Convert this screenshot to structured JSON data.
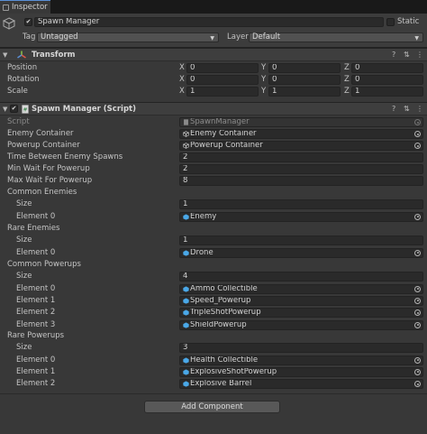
{
  "tab": {
    "label": "Inspector"
  },
  "gameobject": {
    "active": true,
    "name": "Spawn Manager",
    "static_label": "Static",
    "tag_label": "Tag",
    "tag_value": "Untagged",
    "layer_label": "Layer",
    "layer_value": "Default"
  },
  "transform": {
    "title": "Transform",
    "rows": [
      {
        "label": "Position",
        "x": "0",
        "y": "0",
        "z": "0"
      },
      {
        "label": "Rotation",
        "x": "0",
        "y": "0",
        "z": "0"
      },
      {
        "label": "Scale",
        "x": "1",
        "y": "1",
        "z": "1"
      }
    ],
    "axis": {
      "x": "X",
      "y": "Y",
      "z": "Z"
    }
  },
  "script": {
    "title": "Spawn Manager (Script)",
    "script_label": "Script",
    "script_value": "SpawnManager",
    "enemy_container_label": "Enemy Container",
    "enemy_container_value": "Enemy Container",
    "powerup_container_label": "Powerup Container",
    "powerup_container_value": "Powerup Container",
    "time_between_label": "Time Between Enemy Spawns",
    "time_between_value": "2",
    "min_wait_label": "Min Wait For Powerup",
    "min_wait_value": "2",
    "max_wait_label": "Max Wait For Powerup",
    "max_wait_value": "8",
    "size_label": "Size",
    "common_enemies": {
      "label": "Common Enemies",
      "size": "1",
      "elements": [
        {
          "label": "Element 0",
          "value": "Enemy"
        }
      ]
    },
    "rare_enemies": {
      "label": "Rare Enemies",
      "size": "1",
      "elements": [
        {
          "label": "Element 0",
          "value": "Drone"
        }
      ]
    },
    "common_powerups": {
      "label": "Common Powerups",
      "size": "4",
      "elements": [
        {
          "label": "Element 0",
          "value": "Ammo Collectible"
        },
        {
          "label": "Element 1",
          "value": "Speed_Powerup"
        },
        {
          "label": "Element 2",
          "value": "TripleShotPowerup"
        },
        {
          "label": "Element 3",
          "value": "ShieldPowerup"
        }
      ]
    },
    "rare_powerups": {
      "label": "Rare Powerups",
      "size": "3",
      "elements": [
        {
          "label": "Element 0",
          "value": "Health Collectible"
        },
        {
          "label": "Element 1",
          "value": "ExplosiveShotPowerup"
        },
        {
          "label": "Element 2",
          "value": "Explosive Barrel"
        }
      ]
    }
  },
  "add_component": {
    "label": "Add Component"
  },
  "colors": {
    "accent": "#5a8fd6",
    "panel": "#383838",
    "field": "#2a2a2a",
    "prefab": "#4aa8e8"
  }
}
